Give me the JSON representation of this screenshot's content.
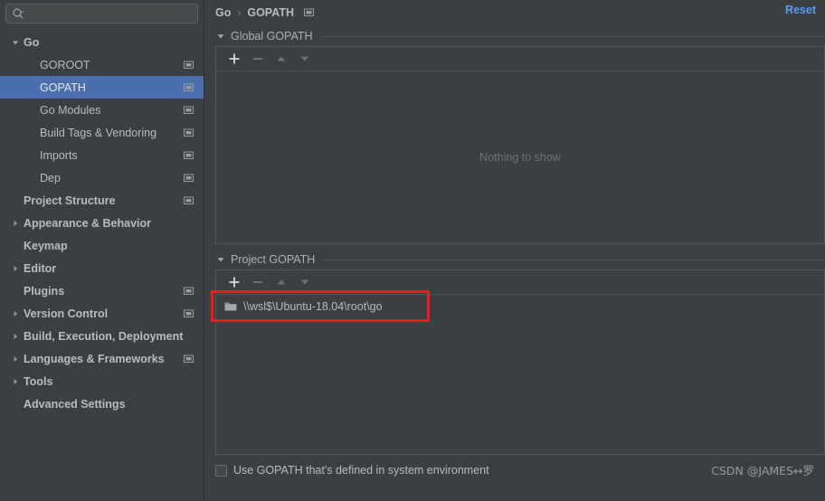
{
  "search": {
    "placeholder": "",
    "value": "",
    "icon": "search-icon"
  },
  "sidebar": {
    "items": [
      {
        "label": "Go",
        "level": 0,
        "bold": true,
        "arrow": "down",
        "win_icon": false,
        "selected": false
      },
      {
        "label": "GOROOT",
        "level": 1,
        "bold": false,
        "arrow": "none",
        "win_icon": true,
        "selected": false
      },
      {
        "label": "GOPATH",
        "level": 1,
        "bold": false,
        "arrow": "none",
        "win_icon": true,
        "selected": true
      },
      {
        "label": "Go Modules",
        "level": 1,
        "bold": false,
        "arrow": "none",
        "win_icon": true,
        "selected": false
      },
      {
        "label": "Build Tags & Vendoring",
        "level": 1,
        "bold": false,
        "arrow": "none",
        "win_icon": true,
        "selected": false
      },
      {
        "label": "Imports",
        "level": 1,
        "bold": false,
        "arrow": "none",
        "win_icon": true,
        "selected": false
      },
      {
        "label": "Dep",
        "level": 1,
        "bold": false,
        "arrow": "none",
        "win_icon": true,
        "selected": false
      },
      {
        "label": "Project Structure",
        "level": 0,
        "bold": true,
        "arrow": "none",
        "win_icon": true,
        "selected": false
      },
      {
        "label": "Appearance & Behavior",
        "level": 0,
        "bold": true,
        "arrow": "right",
        "win_icon": false,
        "selected": false
      },
      {
        "label": "Keymap",
        "level": 0,
        "bold": true,
        "arrow": "none",
        "win_icon": false,
        "selected": false
      },
      {
        "label": "Editor",
        "level": 0,
        "bold": true,
        "arrow": "right",
        "win_icon": false,
        "selected": false
      },
      {
        "label": "Plugins",
        "level": 0,
        "bold": true,
        "arrow": "none",
        "win_icon": true,
        "selected": false
      },
      {
        "label": "Version Control",
        "level": 0,
        "bold": true,
        "arrow": "right",
        "win_icon": true,
        "selected": false
      },
      {
        "label": "Build, Execution, Deployment",
        "level": 0,
        "bold": true,
        "arrow": "right",
        "win_icon": false,
        "selected": false
      },
      {
        "label": "Languages & Frameworks",
        "level": 0,
        "bold": true,
        "arrow": "right",
        "win_icon": true,
        "selected": false
      },
      {
        "label": "Tools",
        "level": 0,
        "bold": true,
        "arrow": "right",
        "win_icon": false,
        "selected": false
      },
      {
        "label": "Advanced Settings",
        "level": 0,
        "bold": true,
        "arrow": "none",
        "win_icon": false,
        "selected": false
      }
    ]
  },
  "header": {
    "breadcrumb": [
      "Go",
      "GOPATH"
    ],
    "crumb_root": "Go",
    "crumb_separator": "›",
    "crumb_leaf": "GOPATH",
    "reset_label": "Reset",
    "accent_link_color": "#589df6"
  },
  "sections": {
    "global": {
      "title": "Global GOPATH",
      "expanded": true,
      "empty_message": "Nothing to show",
      "toolbar": {
        "add_label": "+",
        "remove_label": "−",
        "move_up_label": "▲",
        "move_down_label": "▼"
      },
      "entries": []
    },
    "project": {
      "title": "Project GOPATH",
      "expanded": true,
      "toolbar": {
        "add_label": "+",
        "remove_label": "−",
        "move_up_label": "▲",
        "move_down_label": "▼"
      },
      "entries": [
        {
          "path": "\\\\wsl$\\Ubuntu-18.04\\root\\go",
          "icon": "folder-icon"
        }
      ]
    }
  },
  "footer": {
    "checkbox_label": "Use GOPATH that's defined in system environment",
    "checkbox_checked": false,
    "watermark": "CSDN @JAMES↔罗"
  },
  "annotation": {
    "color": "#ee1c21",
    "shape": "rectangle",
    "target": "project-gopath-entry"
  }
}
